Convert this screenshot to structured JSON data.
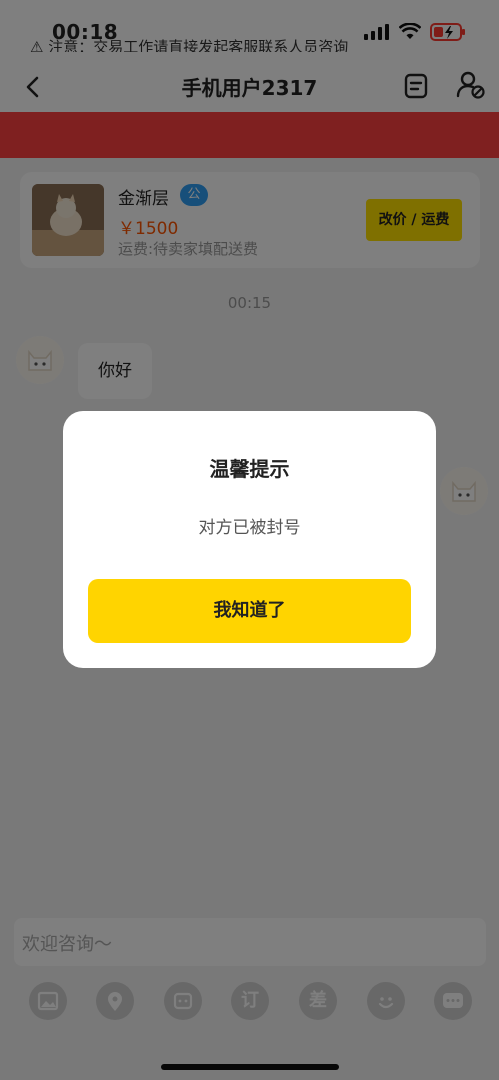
{
  "status_bar": {
    "time": "00:18"
  },
  "nav": {
    "title": "手机用户2317"
  },
  "notice": {
    "text": "⚠ 注意：交易工作请直接发起客服联系人员咨询"
  },
  "product": {
    "name": "金渐层",
    "badge": "公",
    "price": "￥1500",
    "shipping": "运费:待卖家填配送费",
    "action_label": "改价 / 运费"
  },
  "chat": {
    "time": "00:15",
    "messages": [
      {
        "side": "left",
        "text": "你好"
      }
    ]
  },
  "input": {
    "placeholder": "欢迎咨询～"
  },
  "toolbar": {
    "items": [
      {
        "icon": "image-icon"
      },
      {
        "icon": "location-icon"
      },
      {
        "icon": "bear-icon"
      },
      {
        "icon": "order-char-icon",
        "label": "订"
      },
      {
        "icon": "diff-char-icon",
        "label": "差"
      },
      {
        "icon": "emoji-icon"
      },
      {
        "icon": "more-icon"
      }
    ]
  },
  "dialog": {
    "title": "温馨提示",
    "message": "对方已被封号",
    "confirm_label": "我知道了"
  },
  "colors": {
    "accent": "#ffd400",
    "price": "#ff5500",
    "notice": "#ff4040",
    "badge": "#2f9ef5"
  }
}
